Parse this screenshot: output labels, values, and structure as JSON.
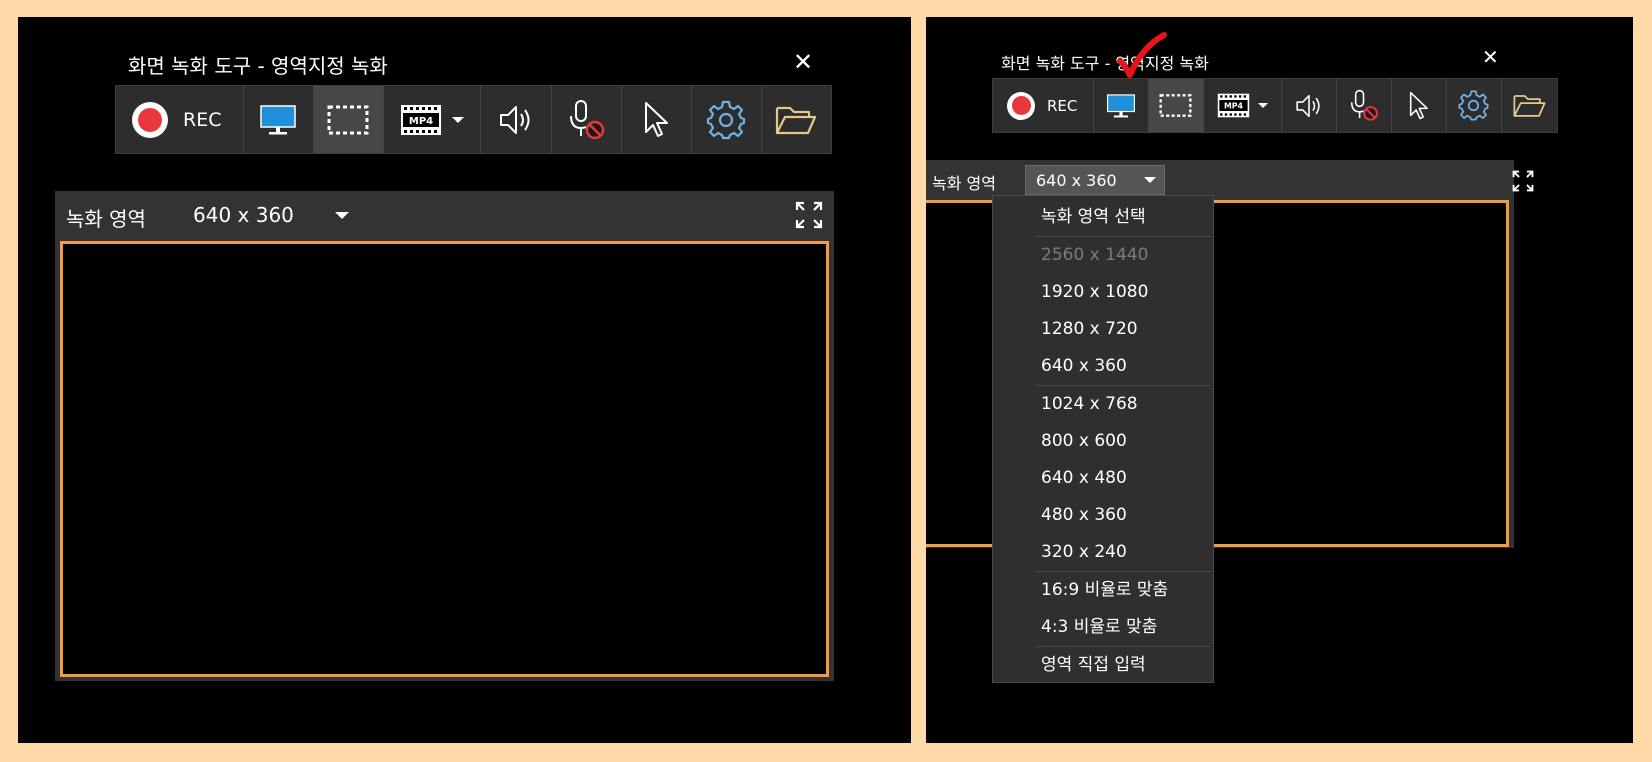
{
  "left": {
    "title": "화면 녹화 도구 - 영역지정 녹화",
    "close_glyph": "✕",
    "toolbar": {
      "rec_label": "REC",
      "buttons": [
        "record-button",
        "monitor-button",
        "region-button",
        "format-mp4-button",
        "speaker-button",
        "mic-muted-button",
        "cursor-button",
        "settings-button",
        "folder-button"
      ],
      "active": "region-button"
    },
    "area": {
      "label": "녹화 영역",
      "size_value": "640 x 360"
    }
  },
  "right": {
    "title": "화면 녹화 도구 - 영역지정 녹화",
    "close_glyph": "✕",
    "toolbar": {
      "rec_label": "REC",
      "active": "region-button"
    },
    "area": {
      "label": "녹화 영역",
      "size_value": "640 x 360"
    },
    "dropdown": {
      "items": [
        {
          "label": "녹화 영역 선택",
          "disabled": false
        },
        {
          "label": "2560 x 1440",
          "disabled": true
        },
        {
          "label": "1920 x 1080",
          "disabled": false
        },
        {
          "label": "1280 x 720",
          "disabled": false
        },
        {
          "label": "640 x 360",
          "disabled": false
        },
        {
          "label": "1024 x 768",
          "disabled": false
        },
        {
          "label": "800 x 600",
          "disabled": false
        },
        {
          "label": "640 x 480",
          "disabled": false
        },
        {
          "label": "480 x 360",
          "disabled": false
        },
        {
          "label": "320 x 240",
          "disabled": false
        },
        {
          "label": "16:9 비율로 맞춤",
          "disabled": false
        },
        {
          "label": "4:3 비율로 맞춤",
          "disabled": false
        },
        {
          "label": "영역 직접 입력",
          "disabled": false
        }
      ]
    },
    "annotation": "red-checkmark"
  },
  "colors": {
    "page_bg": "#ffd9a8",
    "window_bg": "#000000",
    "toolbar_bg": "#2d2d2d",
    "active_button_bg": "#474747",
    "record_red": "#e8383b",
    "frame_orange": "#f2994a",
    "monitor_blue": "#1e8fd8",
    "gear_blue": "#6fb3e8",
    "folder_yellow": "#e3c98c",
    "check_red": "#e8141c"
  }
}
